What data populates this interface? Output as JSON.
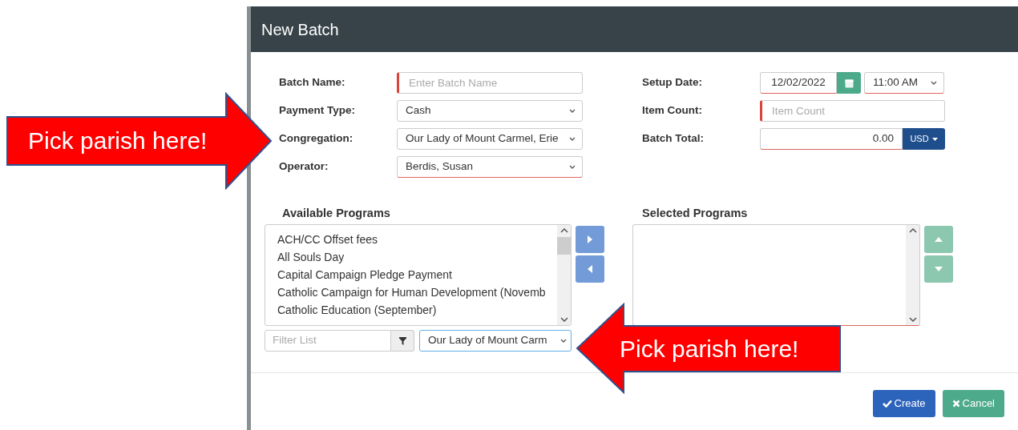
{
  "window": {
    "title": "New Batch"
  },
  "left_fields": [
    {
      "label": "Batch Name:",
      "kind": "text",
      "placeholder": "Enter Batch Name",
      "required": false,
      "error": true
    },
    {
      "label": "Payment Type:",
      "kind": "select",
      "value": "Cash",
      "required": false,
      "error": false
    },
    {
      "label": "Congregation:",
      "kind": "select",
      "value": "Our Lady of Mount Carmel, Erie",
      "required": false,
      "error": false
    },
    {
      "label": "Operator:",
      "kind": "select",
      "value": "Berdis, Susan",
      "required": true,
      "error": false
    }
  ],
  "right_fields": [
    {
      "label": "Setup Date:",
      "kind": "datetime",
      "value": "12/02/2022",
      "time": "11:00 AM",
      "required": true,
      "error": false
    },
    {
      "label": "Item Count:",
      "kind": "text",
      "placeholder": "Item Count",
      "required": false,
      "error": true
    },
    {
      "label": "Batch Total:",
      "kind": "currency",
      "value": "0.00",
      "currency": "USD",
      "required": true,
      "error": false
    }
  ],
  "available_programs": {
    "title": "Available Programs",
    "items": [
      "ACH/CC Offset fees",
      "All Souls Day",
      "Capital Campaign Pledge Payment",
      "Catholic Campaign for Human Development (Novemb",
      "Catholic Education (September)"
    ],
    "filter": {
      "placeholder": "Filter List"
    },
    "parish_select": {
      "value": "Our Lady of Mount Carm",
      "focused": true
    },
    "move_buttons": [
      {
        "kind": "right",
        "disabled": false
      },
      {
        "kind": "left",
        "disabled": false
      }
    ]
  },
  "selected_programs": {
    "title": "Selected Programs",
    "required": true,
    "order_buttons": [
      {
        "kind": "up",
        "disabled": true
      },
      {
        "kind": "down",
        "disabled": true
      }
    ]
  },
  "footer_buttons": [
    {
      "label": "Create",
      "kind": "primary"
    },
    {
      "label": "Cancel",
      "kind": "success"
    }
  ],
  "callouts": [
    {
      "text": "Pick parish here!",
      "kind": "right"
    },
    {
      "text": "Pick parish here!",
      "kind": "left"
    }
  ]
}
